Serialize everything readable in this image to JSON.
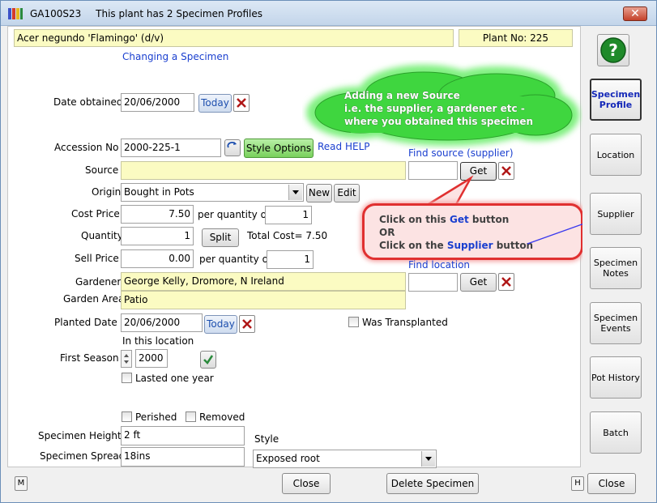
{
  "window": {
    "title_code": "GA100S23",
    "title_message": "This plant has 2 Specimen Profiles",
    "close_glyph": "✕"
  },
  "header": {
    "plant_name": "Acer negundo 'Flamingo' (d/v)",
    "plant_no": "Plant No: 225",
    "changing_link": "Changing a Specimen"
  },
  "form": {
    "date_obtained": {
      "label": "Date obtained",
      "value": "20/06/2000",
      "today": "Today"
    },
    "accession": {
      "label": "Accession No",
      "value": "2000-225-1",
      "style_options": "Style Options",
      "read_help": "Read HELP"
    },
    "source": {
      "label": "Source",
      "value": "",
      "find_link": "Find source (supplier)",
      "get": "Get"
    },
    "origin": {
      "label": "Origin",
      "value": "Bought in Pots",
      "new": "New",
      "edit": "Edit"
    },
    "cost_price": {
      "label": "Cost Price",
      "value": "7.50",
      "per_qty": "per quantity of",
      "qty": "1"
    },
    "quantity": {
      "label": "Quantity",
      "value": "1",
      "split": "Split",
      "total": "Total Cost= 7.50"
    },
    "sell_price": {
      "label": "Sell Price",
      "value": "0.00",
      "per_qty": "per quantity of",
      "qty": "1"
    },
    "gardener": {
      "label": "Gardener",
      "value": "George Kelly, Dromore, N Ireland",
      "find_link": "Find location",
      "get": "Get"
    },
    "garden_area": {
      "label": "Garden Area",
      "value": "Patio"
    },
    "planted_date": {
      "label": "Planted Date",
      "value": "20/06/2000",
      "today": "Today",
      "in_location": "In this location",
      "was_transplanted": "Was Transplanted"
    },
    "first_season": {
      "label": "First Season",
      "value": "2000",
      "lasted_one_year": "Lasted one year"
    },
    "perished": "Perished",
    "removed": "Removed",
    "specimen_height": {
      "label": "Specimen Height",
      "value": "2 ft"
    },
    "specimen_spread": {
      "label": "Specimen Spread",
      "value": "18ins"
    },
    "style": {
      "label": "Style",
      "value": "Exposed root"
    }
  },
  "callouts": {
    "cloud_line1": "Adding a new Source",
    "cloud_line2": "i.e. the supplier, a gardener etc -",
    "cloud_line3": "where you obtained this specimen",
    "note_line1_pre": "Click on this ",
    "note_line1_hl": "Get",
    "note_line1_post": " button",
    "note_line2": "OR",
    "note_line3_pre": "Click on the ",
    "note_line3_hl": "Supplier",
    "note_line3_post": " button"
  },
  "sidebar": {
    "help_glyph": "?",
    "items": [
      {
        "label": "Specimen Profile",
        "active": true
      },
      {
        "label": "Location",
        "active": false
      },
      {
        "label": "Supplier",
        "active": false
      },
      {
        "label": "Specimen Notes",
        "active": false
      },
      {
        "label": "Specimen Events",
        "active": false
      },
      {
        "label": "Pot History",
        "active": false
      },
      {
        "label": "Batch",
        "active": false
      }
    ]
  },
  "footer": {
    "m_label": "M",
    "h_label": "H",
    "close": "Close",
    "delete": "Delete Specimen",
    "close2": "Close"
  },
  "colors": {
    "field_yellow": "#fbfbc2",
    "today_blue": "#1d4fae",
    "link_blue": "#1a3fcf",
    "style_green": "#79d05c",
    "x_red": "#b01818",
    "cloud_green": "#3fd63f",
    "note_red": "#e03030"
  }
}
